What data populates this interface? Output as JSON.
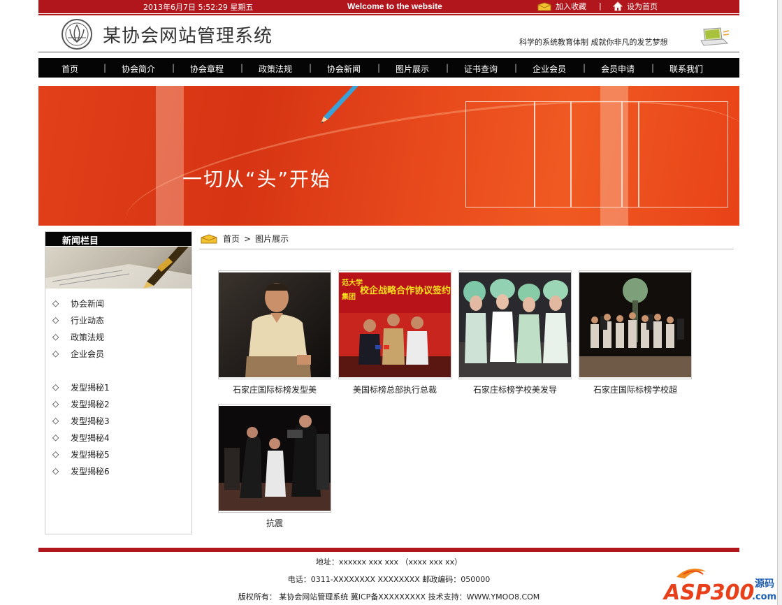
{
  "topbar": {
    "datetime": "2013年6月7日 5:52:29 星期五",
    "welcome": "Welcome to the website",
    "bookmark": "加入收藏",
    "separator": "|",
    "set_home": "设为首页"
  },
  "header": {
    "site_name": "某协会网站管理系统",
    "slogan": "科学的系统教育体制 成就你非凡的发艺梦想"
  },
  "nav": {
    "items": [
      "首页",
      "协会简介",
      "协会章程",
      "政策法规",
      "协会新闻",
      "图片展示",
      "证书查询",
      "企业会员",
      "会员申请",
      "联系我们"
    ],
    "separator": "|"
  },
  "banner": {
    "headline": "一切从“头”开始"
  },
  "sidebar": {
    "title": "新闻栏目",
    "group1": [
      "协会新闻",
      "行业动态",
      "政策法规",
      "企业会员"
    ],
    "group2": [
      "发型揭秘1",
      "发型揭秘2",
      "发型揭秘3",
      "发型揭秘4",
      "发型揭秘5",
      "发型揭秘6"
    ],
    "bullet": "◇"
  },
  "breadcrumb": {
    "home": "首页",
    "arrow": ">",
    "current": "图片展示"
  },
  "gallery": {
    "items": [
      {
        "caption": "石家庄国际标榜发型美"
      },
      {
        "caption": "美国标榜总部执行总裁"
      },
      {
        "caption": "石家庄标榜学校美发导"
      },
      {
        "caption": "石家庄国际标榜学校超"
      },
      {
        "caption": "抗震"
      }
    ],
    "photo2_text": "校企战略合作协议签约仪式",
    "photo2_text2": "范大学",
    "photo2_text3": "集团"
  },
  "footer": {
    "address": "地址：xxxxxx xxx xxx （xxxx xxx xx）",
    "phone": "电话：0311-XXXXXXXX XXXXXXXX 邮政编码：050000",
    "copyright": "版权所有： 某协会网站管理系统 冀ICP备XXXXXXXXX 技术支持：WWW.YMOO8.COM"
  },
  "watermark": {
    "brand": "ASP300",
    "suffix": "源码",
    "domain": ".com"
  },
  "colors": {
    "brand_red": "#b0161c",
    "nav_black": "#050505",
    "banner_orange": "#e2401a"
  }
}
